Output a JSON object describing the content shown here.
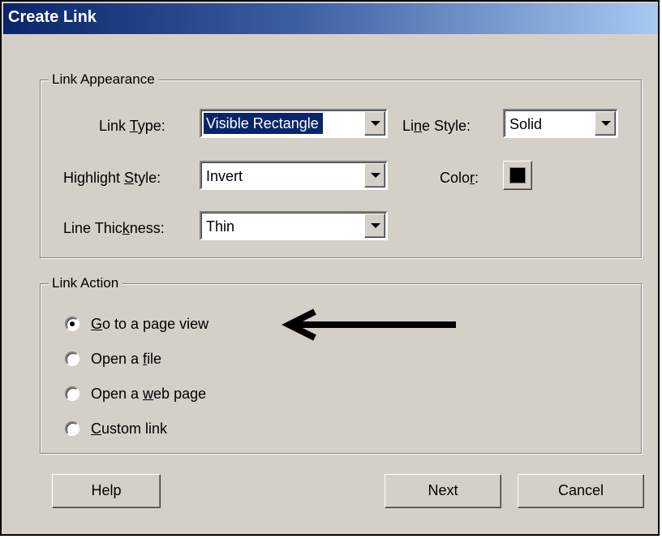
{
  "dialog": {
    "title": "Create Link"
  },
  "appearance": {
    "group_title": "Link Appearance",
    "link_type": {
      "label_pre": "Link ",
      "label_key": "T",
      "label_post": "ype:",
      "value": "Visible Rectangle"
    },
    "line_style": {
      "label_pre": "Li",
      "label_key": "n",
      "label_post": "e Style:",
      "value": "Solid"
    },
    "highlight_style": {
      "label_pre": "Highlight ",
      "label_key": "S",
      "label_post": "tyle:",
      "value": "Invert"
    },
    "color": {
      "label_pre": "Colo",
      "label_key": "r",
      "label_post": ":",
      "value": "#000000"
    },
    "line_thickness": {
      "label_pre": "Line Thic",
      "label_key": "k",
      "label_post": "ness:",
      "value": "Thin"
    }
  },
  "action": {
    "group_title": "Link Action",
    "options": [
      {
        "pre": "",
        "key": "G",
        "post": "o to a page view",
        "checked": true
      },
      {
        "pre": "Open a ",
        "key": "f",
        "post": "ile",
        "checked": false
      },
      {
        "pre": "Open a ",
        "key": "w",
        "post": "eb page",
        "checked": false
      },
      {
        "pre": "",
        "key": "C",
        "post": "ustom link",
        "checked": false
      }
    ]
  },
  "buttons": {
    "help": "Help",
    "next": "Next",
    "cancel": "Cancel"
  },
  "colors": {
    "title_start": "#0a246a",
    "title_end": "#a6caf0",
    "face": "#d4d0c8",
    "selection": "#0a246a"
  }
}
